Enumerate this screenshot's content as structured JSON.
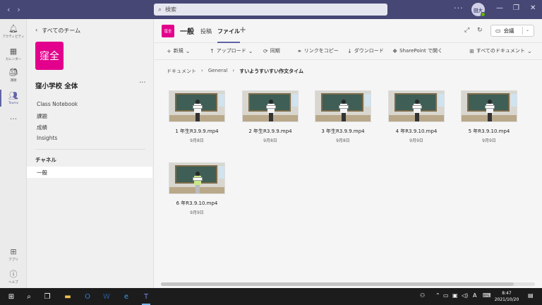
{
  "titlebar": {
    "search_placeholder": "検索",
    "avatar_initials": "田大"
  },
  "rail": [
    {
      "label": "アクティビティ",
      "icon": "bell-icon"
    },
    {
      "label": "カレンダー",
      "icon": "calendar-icon"
    },
    {
      "label": "課題",
      "icon": "assignments-icon"
    },
    {
      "label": "Teams",
      "icon": "teams-icon"
    },
    {
      "label": "",
      "icon": "more-apps-icon"
    },
    {
      "label": "アプリ",
      "icon": "apps-icon"
    },
    {
      "label": "ヘルプ",
      "icon": "help-icon"
    }
  ],
  "team_panel": {
    "back_label": "すべてのチーム",
    "team_avatar_text": "窪全",
    "team_name": "窪小学校 全体",
    "links": [
      "Class Notebook",
      "課題",
      "成績",
      "Insights"
    ],
    "channels_heading": "チャネル",
    "selected_channel": "一般"
  },
  "channel_header": {
    "avatar_text": "窪全",
    "name": "一般",
    "tabs": [
      "投稿",
      "ファイル"
    ],
    "active_tab": "ファイル",
    "meet_label": "会議"
  },
  "toolbar": {
    "new": "新規",
    "upload": "アップロード",
    "sync": "同期",
    "copy_link": "リンクをコピー",
    "download": "ダウンロード",
    "sharepoint": "SharePoint で開く",
    "all_docs": "すべてのドキュメント"
  },
  "breadcrumb": [
    "ドキュメント",
    "General",
    "すいようすいすい作文タイム"
  ],
  "files": [
    {
      "name": "1 年生R3.9.9.mp4",
      "date": "9月8日"
    },
    {
      "name": "2 年生R3.9.9.mp4",
      "date": "9月8日"
    },
    {
      "name": "3 年生R3.9.9.mp4",
      "date": "9月8日"
    },
    {
      "name": "4 年R3.9.10.mp4",
      "date": "9月9日"
    },
    {
      "name": "5 年R3.9.10.mp4",
      "date": "9月9日"
    },
    {
      "name": "6 年R3.9.10.mp4",
      "date": "9月9日"
    }
  ],
  "taskbar": {
    "ime": "A",
    "time": "8:47",
    "date": "2021/10/20"
  }
}
